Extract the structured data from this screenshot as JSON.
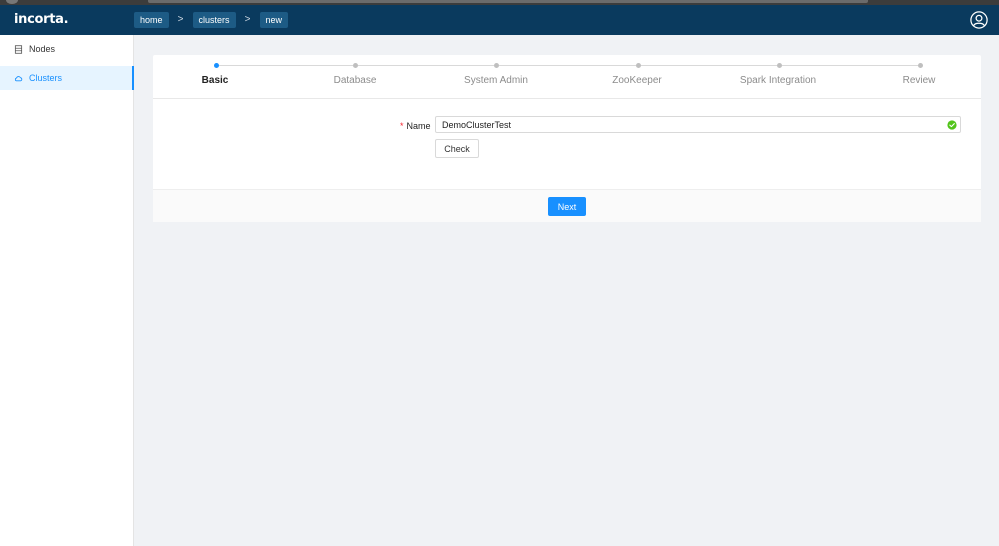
{
  "app": {
    "logo": "incorta."
  },
  "breadcrumbs": [
    "home",
    "clusters",
    "new"
  ],
  "sidebar": {
    "items": [
      {
        "label": "Nodes",
        "icon": "server-icon",
        "active": false
      },
      {
        "label": "Clusters",
        "icon": "cloud-icon",
        "active": true
      }
    ]
  },
  "steps": {
    "items": [
      {
        "label": "Basic",
        "active": true
      },
      {
        "label": "Database",
        "active": false
      },
      {
        "label": "System Admin",
        "active": false
      },
      {
        "label": "ZooKeeper",
        "active": false
      },
      {
        "label": "Spark Integration",
        "active": false
      },
      {
        "label": "Review",
        "active": false
      }
    ]
  },
  "form": {
    "required_mark": "*",
    "name_label": "Name",
    "name_value": "DemoClusterTest",
    "check_label": "Check"
  },
  "footer": {
    "next_label": "Next"
  },
  "colors": {
    "header": "#0a3a5e",
    "accent": "#1890ff",
    "success": "#52c41a",
    "required": "#f5222d"
  }
}
